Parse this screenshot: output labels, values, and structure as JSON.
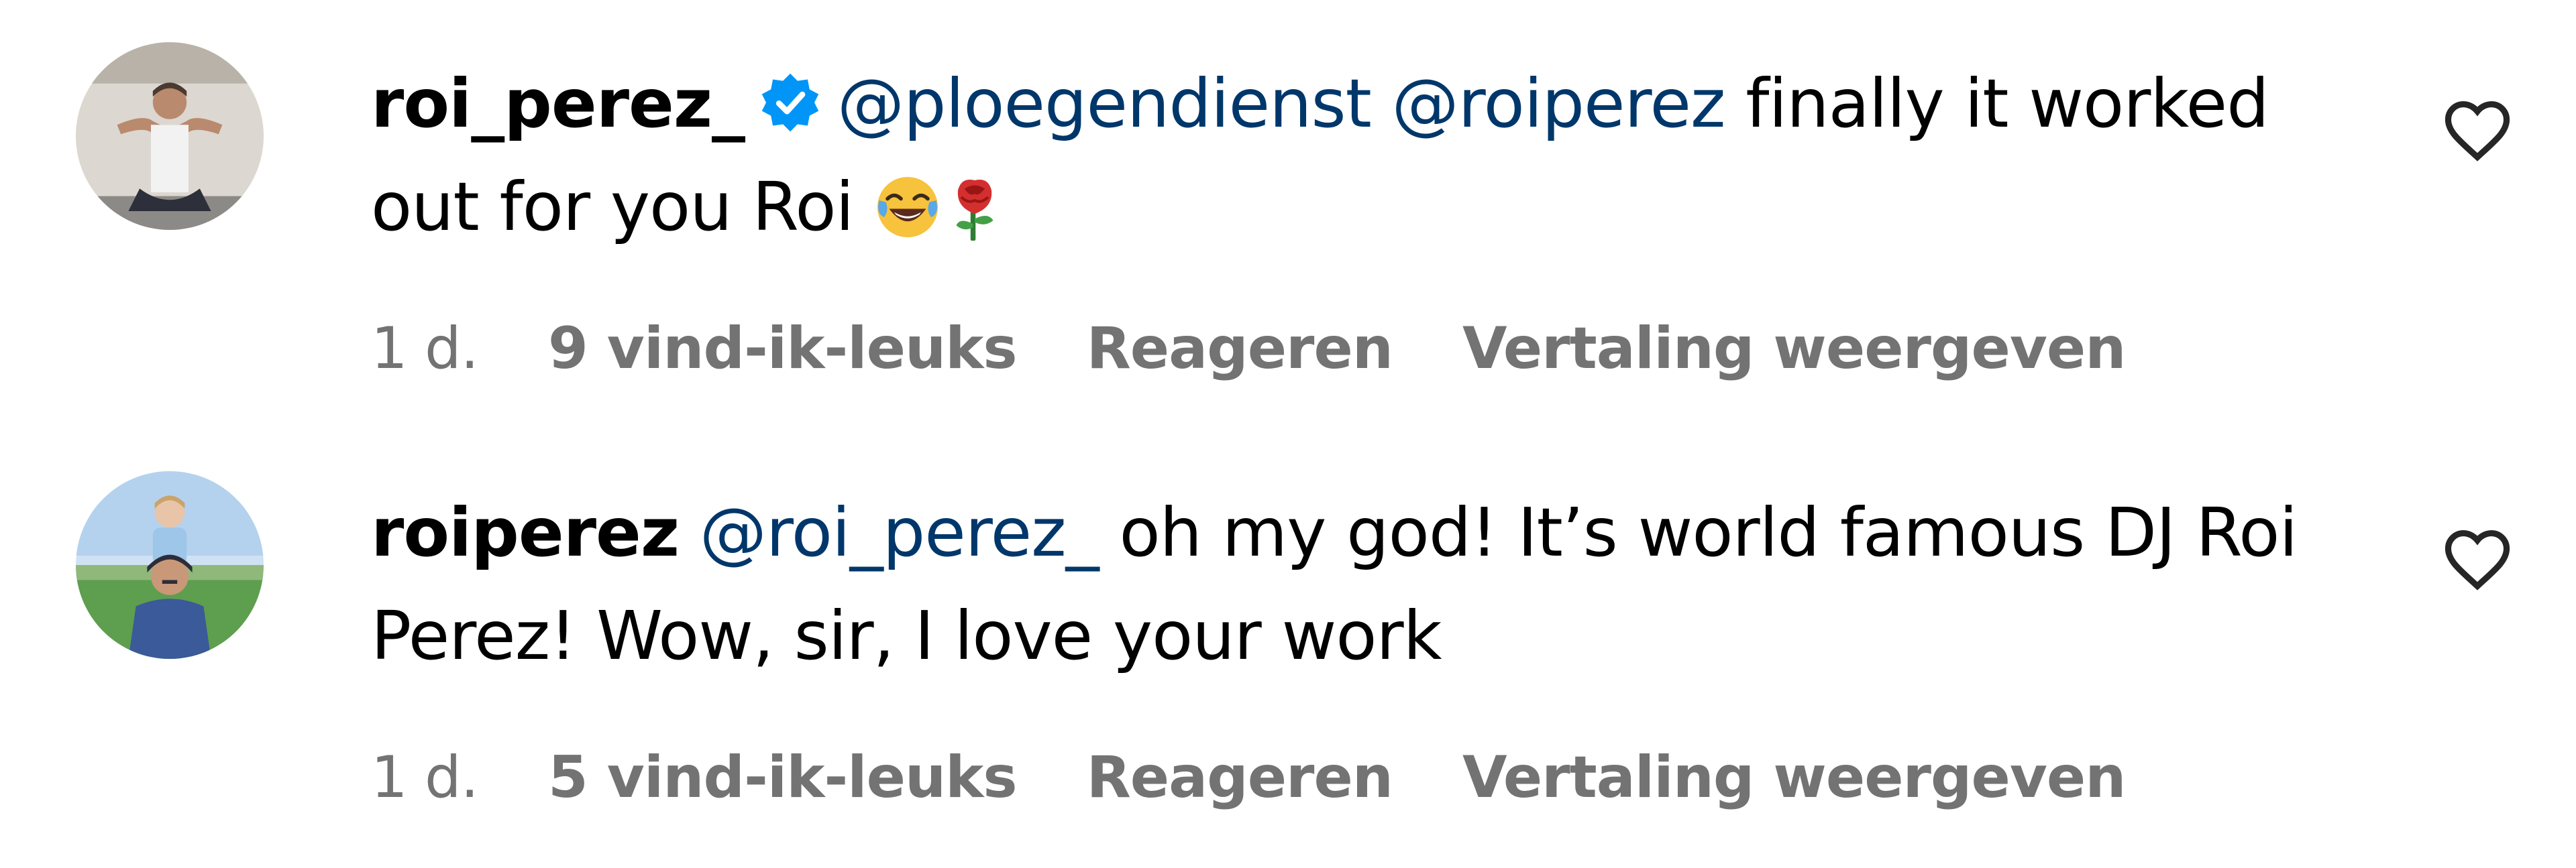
{
  "comments": [
    {
      "username": "roi_perez_",
      "verified": true,
      "avatar": "avatar-man-seated-white-tank-top",
      "mentions": [
        "@ploegendienst",
        "@roiperez"
      ],
      "text_line": "finally it worked out for you Roi",
      "emojis": [
        "face-with-tears-of-joy-emoji",
        "rose-emoji"
      ],
      "time": "1 d.",
      "likes": "9 vind-ik-leuks",
      "reply_label": "Reageren",
      "translate_label": "Vertaling weergeven",
      "like_icon": "heart-outline-icon"
    },
    {
      "username": "roiperez",
      "verified": false,
      "avatar": "avatar-man-with-child-on-shoulders",
      "mentions": [
        "@roi_perez_"
      ],
      "text_line": "oh my god! It’s world famous DJ Roi Perez! Wow, sir, I love your work",
      "emojis": [],
      "time": "1 d.",
      "likes": "5 vind-ik-leuks",
      "reply_label": "Reageren",
      "translate_label": "Vertaling weergeven",
      "like_icon": "heart-outline-icon"
    }
  ],
  "colors": {
    "text": "#000000",
    "mention": "#00376b",
    "meta": "#737373",
    "verified_blue": "#0095f6"
  }
}
